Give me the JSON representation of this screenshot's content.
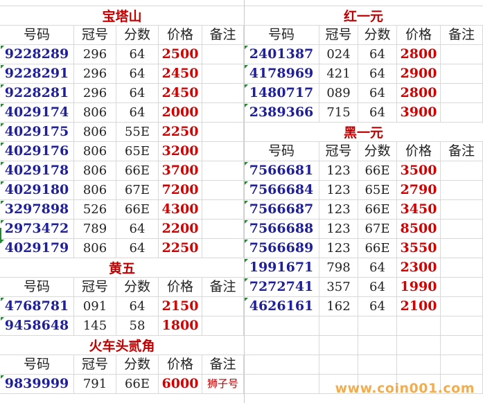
{
  "sections": {
    "baotashan": {
      "title": "宝塔山",
      "headers": [
        "号码",
        "冠号",
        "分数",
        "价格",
        "备注"
      ],
      "rows": [
        [
          "9228289",
          "296",
          "64",
          "2500",
          ""
        ],
        [
          "9228291",
          "296",
          "64",
          "2450",
          ""
        ],
        [
          "9228281",
          "296",
          "64",
          "2450",
          ""
        ],
        [
          "4029174",
          "806",
          "64",
          "2000",
          ""
        ],
        [
          "4029175",
          "806",
          "55E",
          "2250",
          ""
        ],
        [
          "4029176",
          "806",
          "65E",
          "3200",
          ""
        ],
        [
          "4029178",
          "806",
          "66E",
          "3700",
          ""
        ],
        [
          "4029180",
          "806",
          "67E",
          "7200",
          ""
        ],
        [
          "3297898",
          "526",
          "66E",
          "4300",
          ""
        ],
        [
          "2973472",
          "789",
          "64",
          "2200",
          ""
        ],
        [
          "4029179",
          "806",
          "64",
          "2250",
          ""
        ]
      ]
    },
    "huangwu": {
      "title": "黄五",
      "headers": [
        "号码",
        "冠号",
        "分数",
        "价格",
        "备注"
      ],
      "rows": [
        [
          "4768781",
          "091",
          "64",
          "2150",
          ""
        ],
        [
          "9458648",
          "145",
          "58",
          "1800",
          ""
        ]
      ]
    },
    "huochetou": {
      "title": "火车头贰角",
      "headers": [
        "号码",
        "冠号",
        "分数",
        "价格",
        "备注"
      ],
      "rows": [
        [
          "9839999",
          "791",
          "66E",
          "6000",
          "狮子号"
        ]
      ]
    },
    "hongyiyuan": {
      "title": "红一元",
      "headers": [
        "号码",
        "冠号",
        "分数",
        "价格",
        "备注"
      ],
      "rows": [
        [
          "2401387",
          "024",
          "64",
          "2800",
          ""
        ],
        [
          "4178969",
          "421",
          "64",
          "2900",
          ""
        ],
        [
          "1480717",
          "089",
          "64",
          "2800",
          ""
        ],
        [
          "2389366",
          "715",
          "64",
          "3900",
          ""
        ]
      ]
    },
    "heiyiyuan": {
      "title": "黑一元",
      "headers": [
        "号码",
        "冠号",
        "分数",
        "价格",
        "备注"
      ],
      "rows": [
        [
          "7566681",
          "123",
          "66E",
          "3500",
          ""
        ],
        [
          "7566684",
          "123",
          "65E",
          "2790",
          ""
        ],
        [
          "7566687",
          "123",
          "66E",
          "3450",
          ""
        ],
        [
          "7566688",
          "123",
          "67E",
          "8500",
          ""
        ],
        [
          "7566689",
          "123",
          "66E",
          "3550",
          ""
        ],
        [
          "1991671",
          "798",
          "64",
          "2300",
          ""
        ],
        [
          "7272741",
          "357",
          "64",
          "1990",
          ""
        ],
        [
          "4626161",
          "162",
          "64",
          "2100",
          ""
        ]
      ]
    }
  },
  "watermark": "www.coin001.com"
}
